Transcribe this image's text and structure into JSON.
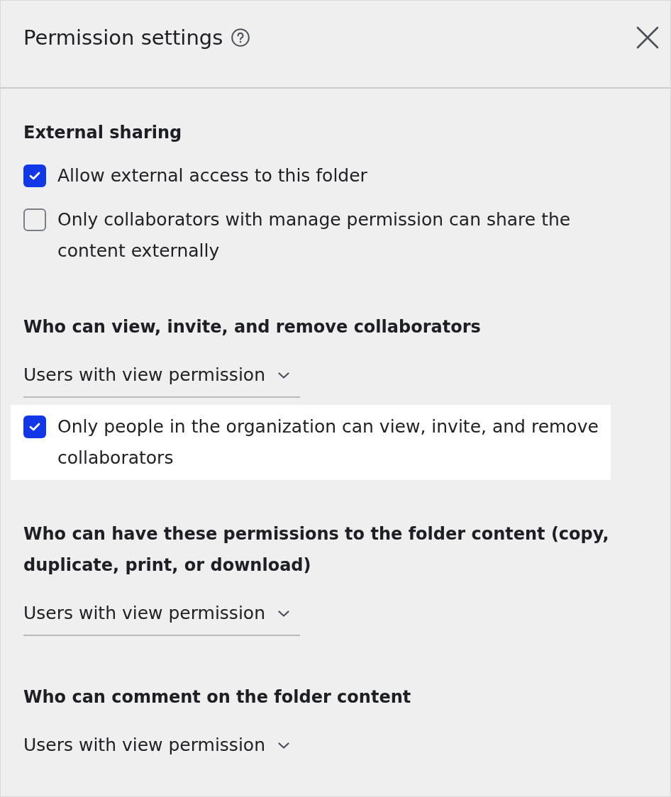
{
  "dialog": {
    "title": "Permission settings"
  },
  "sections": [
    {
      "heading": "External sharing",
      "controls": [
        {
          "kind": "checkbox",
          "label": "Allow external access to this folder",
          "checked": true,
          "highlighted": false
        },
        {
          "kind": "checkbox",
          "label": "Only collaborators with manage permission can share the content externally",
          "checked": false,
          "highlighted": false
        }
      ]
    },
    {
      "heading": "Who can view, invite, and remove collaborators",
      "controls": [
        {
          "kind": "dropdown",
          "value": "Users with view permission",
          "underlined": true
        },
        {
          "kind": "checkbox",
          "label": "Only people in the organization can view, invite, and remove collaborators",
          "checked": true,
          "highlighted": true
        }
      ]
    },
    {
      "heading": "Who can have these permissions to the folder content (copy, duplicate, print, or download)",
      "controls": [
        {
          "kind": "dropdown",
          "value": "Users with view permission",
          "underlined": true
        }
      ]
    },
    {
      "heading": "Who can comment on the folder content",
      "controls": [
        {
          "kind": "dropdown",
          "value": "Users with view permission",
          "underlined": false
        }
      ]
    }
  ]
}
